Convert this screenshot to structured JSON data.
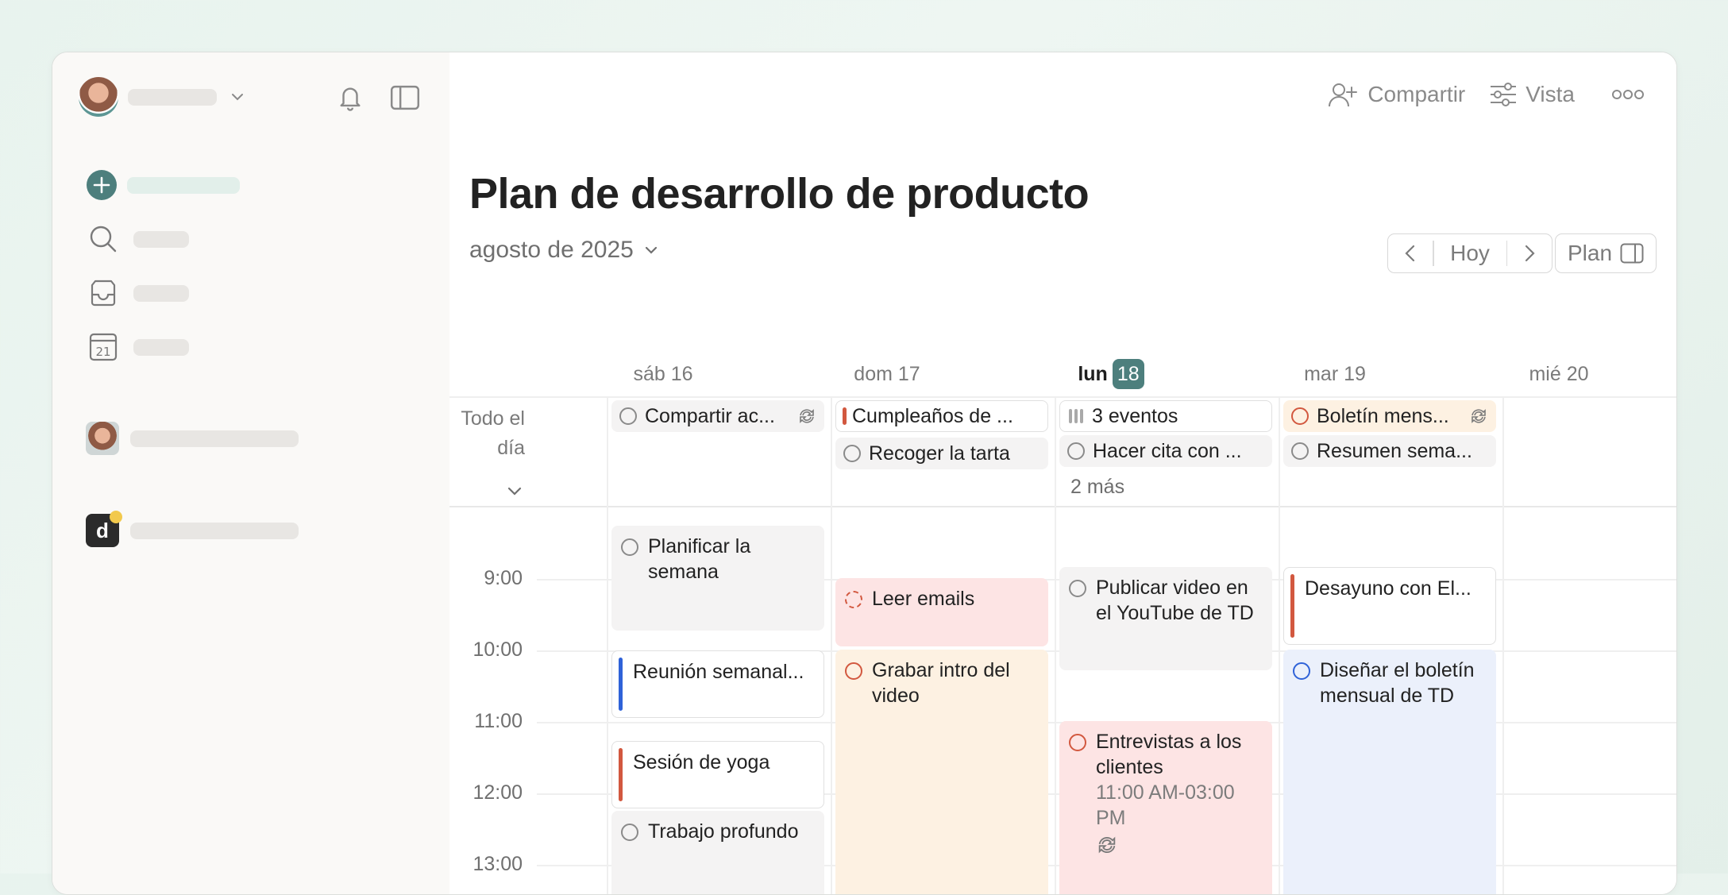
{
  "toolbar": {
    "share_label": "Compartir",
    "view_label": "Vista"
  },
  "page": {
    "title": "Plan de desarrollo de producto",
    "month": "agosto de 2025"
  },
  "nav": {
    "today_label": "Hoy",
    "plan_label": "Plan"
  },
  "calendar": {
    "days": [
      {
        "label": "sáb 16"
      },
      {
        "label": "dom 17"
      },
      {
        "label": "lun",
        "num": "18",
        "today": true
      },
      {
        "label": "mar 19"
      },
      {
        "label": "mié 20"
      }
    ],
    "allday_label": "Todo el día",
    "allday": {
      "sat": [
        "Compartir ac..."
      ],
      "sun": [
        "Cumpleaños de ...",
        "Recoger la tarta"
      ],
      "mon": [
        "3 eventos",
        "Hacer cita con ...",
        "2 más"
      ],
      "tue": [
        "Boletín mens...",
        "Resumen sema..."
      ]
    },
    "times": [
      "9:00",
      "10:00",
      "11:00",
      "12:00",
      "13:00"
    ],
    "events": {
      "sat_1": "Planificar la semana",
      "sat_2": "Reunión semanal...",
      "sat_3": "Sesión de yoga",
      "sat_4": "Trabajo profundo",
      "sun_1": "Leer emails",
      "sun_2": "Grabar intro del video",
      "mon_1": "Publicar video en el YouTube de TD",
      "mon_2": "Entrevistas a los clientes",
      "mon_2_time": "11:00 AM-03:00 PM",
      "tue_1": "Desayuno con El...",
      "tue_2": "Diseñar el boletín mensual de TD"
    }
  },
  "colors": {
    "accent": "#4d7f7d",
    "red": "#d2583f",
    "blue": "#2f62d8",
    "pink_bg": "#fde4e4",
    "peach_bg": "#fdf1e2",
    "blue_bg": "#ebf0fb",
    "gray_bg": "#f4f3f3"
  }
}
